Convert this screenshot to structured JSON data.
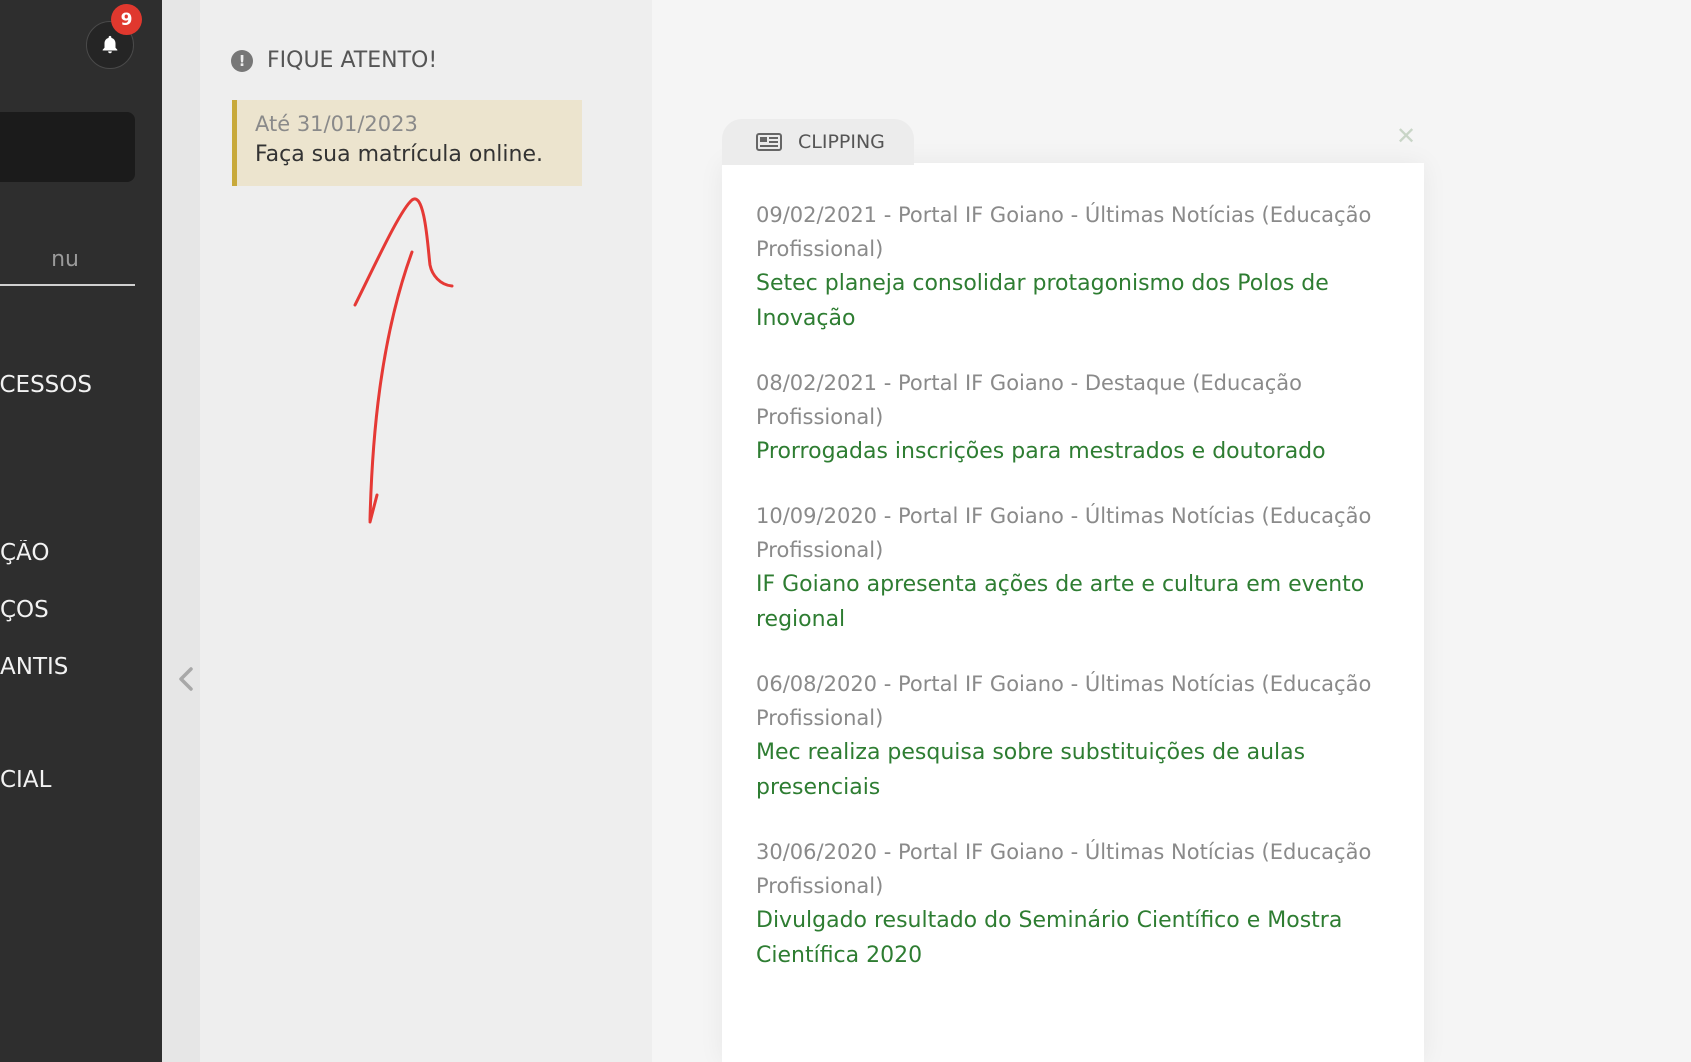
{
  "sidebar": {
    "notification_count": "9",
    "search_placeholder": "nu",
    "menu": [
      {
        "label": "OCESSOS"
      },
      {
        "label": "ÇÃO"
      },
      {
        "label": "ÇOS"
      },
      {
        "label": "ANTIS"
      },
      {
        "label": "CIAL"
      }
    ]
  },
  "alert": {
    "title": "FIQUE ATENTO!",
    "icon": "exclamation-circle-icon",
    "notice_date": "Até 31/01/2023",
    "notice_text": "Faça sua matrícula online."
  },
  "clipping": {
    "tab_label": "CLIPPING",
    "tab_icon": "newspaper-icon",
    "close_icon": "close-icon",
    "items": [
      {
        "meta": "09/02/2021 - Portal IF Goiano - Últimas Notícias (Educação Profissional)",
        "title": "Setec planeja consolidar protagonismo dos Polos de Inovação"
      },
      {
        "meta": "08/02/2021 - Portal IF Goiano - Destaque (Educação Profissional)",
        "title": "Prorrogadas inscrições para mestrados e doutorado"
      },
      {
        "meta": "10/09/2020 - Portal IF Goiano - Últimas Notícias (Educação Profissional)",
        "title": "IF Goiano apresenta ações de arte e cultura em evento regional"
      },
      {
        "meta": "06/08/2020 - Portal IF Goiano - Últimas Notícias (Educação Profissional)",
        "title": "Mec realiza pesquisa sobre substituições de aulas presenciais"
      },
      {
        "meta": "30/06/2020 - Portal IF Goiano - Últimas Notícias (Educação Profissional)",
        "title": "Divulgado resultado do Seminário Científico e Mostra Científica 2020"
      }
    ]
  },
  "colors": {
    "sidebar_bg": "#2e2e2e",
    "badge": "#e0382e",
    "notice_bg": "#ece4ce",
    "notice_border": "#c8a93a",
    "link_green": "#2e7d32",
    "annotation_red": "#e53935"
  }
}
